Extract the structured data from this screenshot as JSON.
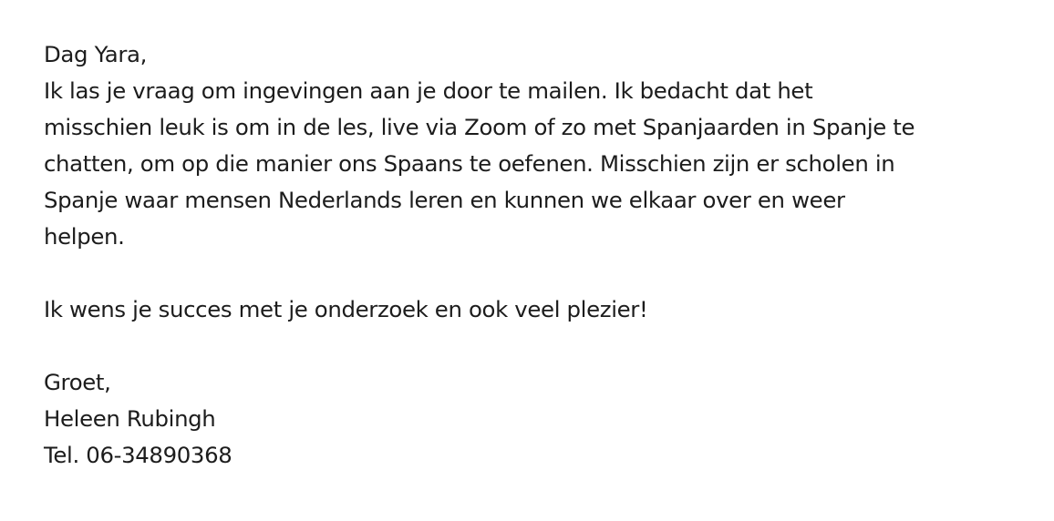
{
  "email": {
    "greeting": "Dag Yara,",
    "body_lines": [
      "Ik las je vraag om ingevingen aan je door te mailen. Ik bedacht dat het",
      "misschien leuk is om in de les, live via Zoom of zo met Spanjaarden in Spanje te",
      "chatten, om op die manier ons Spaans te oefenen. Misschien zijn er scholen in",
      "Spanje waar mensen Nederlands leren en kunnen we elkaar over en weer",
      "helpen."
    ],
    "wish": "Ik wens je succes met je onderzoek en ook veel plezier!",
    "closing": "Groet,",
    "signature_name": "Heleen Rubingh",
    "signature_phone": "Tel. 06-34890368"
  }
}
